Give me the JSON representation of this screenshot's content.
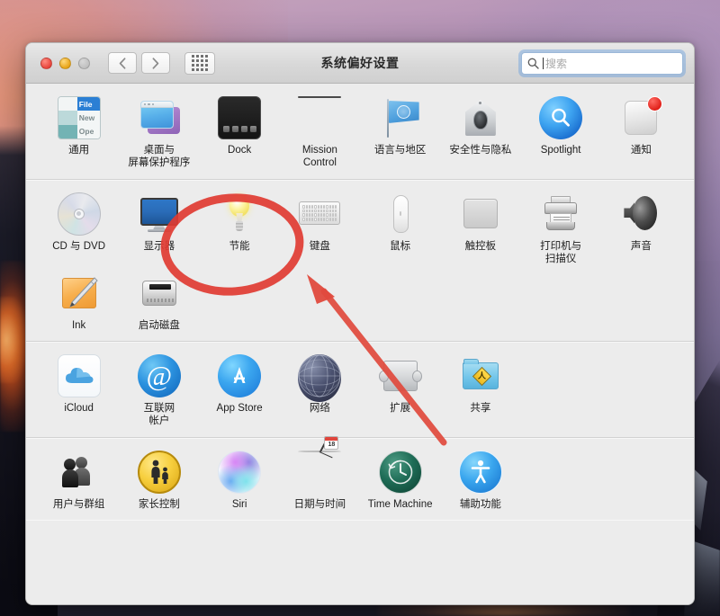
{
  "window": {
    "title": "系统偏好设置",
    "traffic_lights": [
      {
        "name": "close",
        "color": "#e8453c"
      },
      {
        "name": "minimize",
        "color": "#e8a417"
      },
      {
        "name": "zoom",
        "color": "#c0c0c0"
      }
    ],
    "nav": {
      "back_label": "‹",
      "forward_label": "›"
    },
    "show_all_label": "显示全部"
  },
  "search": {
    "placeholder": "搜索",
    "icon": "search-icon",
    "focused": true,
    "accent": "#6aa0de"
  },
  "panes": [
    {
      "section": "personal",
      "items": [
        {
          "label": "通用",
          "icon": "general-icon"
        },
        {
          "label": "桌面与\n屏幕保护程序",
          "icon": "desktop-screensaver-icon"
        },
        {
          "label": "Dock",
          "icon": "dock-icon"
        },
        {
          "label": "Mission\nControl",
          "icon": "mission-control-icon"
        },
        {
          "label": "语言与地区",
          "icon": "language-region-icon"
        },
        {
          "label": "安全性与隐私",
          "icon": "security-privacy-icon"
        },
        {
          "label": "Spotlight",
          "icon": "spotlight-icon"
        },
        {
          "label": "通知",
          "icon": "notifications-icon"
        }
      ]
    },
    {
      "section": "hardware",
      "items": [
        {
          "label": "CD 与 DVD",
          "icon": "cd-dvd-icon"
        },
        {
          "label": "显示器",
          "icon": "displays-icon"
        },
        {
          "label": "节能",
          "icon": "energy-saver-icon",
          "highlighted": true
        },
        {
          "label": "键盘",
          "icon": "keyboard-icon"
        },
        {
          "label": "鼠标",
          "icon": "mouse-icon"
        },
        {
          "label": "触控板",
          "icon": "trackpad-icon"
        },
        {
          "label": "打印机与\n扫描仪",
          "icon": "printers-scanners-icon"
        },
        {
          "label": "声音",
          "icon": "sound-icon"
        },
        {
          "label": "Ink",
          "icon": "ink-icon"
        },
        {
          "label": "启动磁盘",
          "icon": "startup-disk-icon"
        }
      ]
    },
    {
      "section": "internet",
      "items": [
        {
          "label": "iCloud",
          "icon": "icloud-icon"
        },
        {
          "label": "互联网\n帐户",
          "icon": "internet-accounts-icon"
        },
        {
          "label": "App Store",
          "icon": "app-store-icon"
        },
        {
          "label": "网络",
          "icon": "network-icon"
        },
        {
          "label": "扩展",
          "icon": "extensions-icon"
        },
        {
          "label": "共享",
          "icon": "sharing-icon"
        }
      ]
    },
    {
      "section": "system",
      "items": [
        {
          "label": "用户与群组",
          "icon": "users-groups-icon"
        },
        {
          "label": "家长控制",
          "icon": "parental-controls-icon"
        },
        {
          "label": "Siri",
          "icon": "siri-icon"
        },
        {
          "label": "日期与时间",
          "icon": "date-time-icon"
        },
        {
          "label": "Time Machine",
          "icon": "time-machine-icon"
        },
        {
          "label": "辅助功能",
          "icon": "accessibility-icon"
        }
      ]
    }
  ],
  "annotations": {
    "ellipse": {
      "name": "red-ellipse-highlight",
      "color": "#e03b32",
      "target": "节能"
    },
    "arrow": {
      "name": "red-arrow-pointer",
      "color": "#e04a3d",
      "target": "节能"
    }
  },
  "icons": {
    "general_menu": {
      "file": "File",
      "new": "New",
      "open": "Ope"
    },
    "date_time_day": "18",
    "sharing_sign": "人"
  }
}
